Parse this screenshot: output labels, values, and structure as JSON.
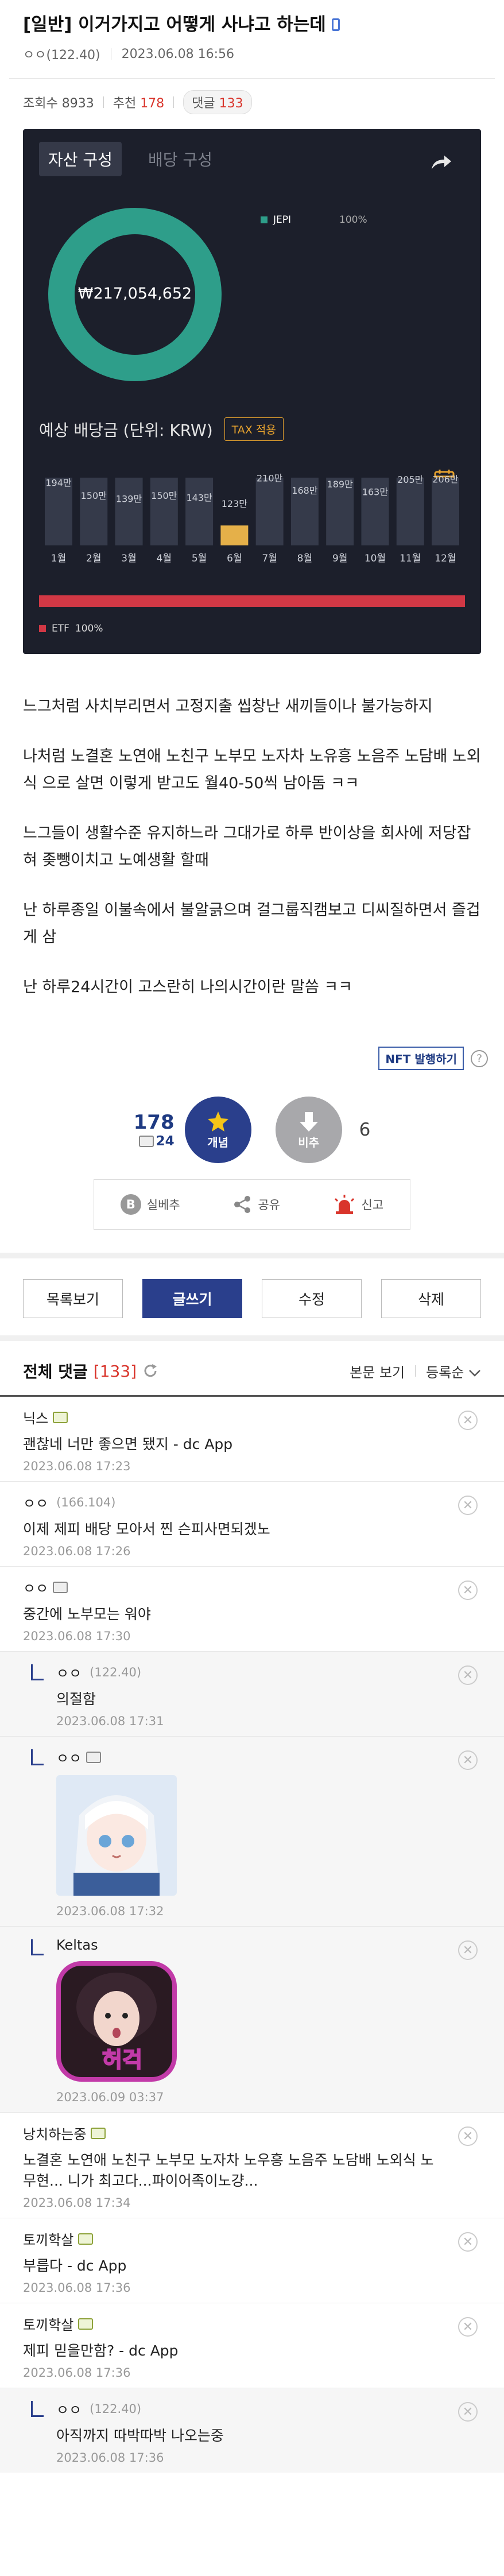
{
  "post": {
    "title": "[일반] 이거가지고 어떻게 사냐고 하는데",
    "author": "ㅇㅇ(122.40)",
    "date": "2023.06.08 16:56",
    "views_label": "조회수 8933",
    "recommend_label": "추천",
    "recommend_count": "178",
    "reply_label": "댓글",
    "reply_count": "133"
  },
  "card": {
    "tab_active": "자산 구성",
    "tab_inactive": "배당 구성",
    "total": "₩217,054,652",
    "legend_name": "JEPI",
    "legend_pct": "100%",
    "dividend_title": "예상 배당금 (단위: KRW)",
    "tax_badge": "TAX 적용",
    "etf_label": "ETF",
    "etf_pct": "100%",
    "colors": {
      "donut": "#2e9e8a",
      "bar": "#353a4a",
      "bar_highlight": "#e5b049",
      "strip": "#d13845"
    }
  },
  "chart_data": {
    "type": "bar",
    "categories": [
      "1월",
      "2월",
      "3월",
      "4월",
      "5월",
      "6월",
      "7월",
      "8월",
      "9월",
      "10월",
      "11월",
      "12월"
    ],
    "values": [
      194,
      150,
      139,
      150,
      143,
      123,
      210,
      168,
      189,
      163,
      205,
      206
    ],
    "value_labels": [
      "194만",
      "150만",
      "139만",
      "150만",
      "143만",
      "123만",
      "210만",
      "168만",
      "189만",
      "163만",
      "205만",
      "206만"
    ],
    "highlight_index": 5,
    "title": "예상 배당금 (단위: KRW)"
  },
  "body": [
    "느그처럼 사치부리면서 고정지출 씹창난 새끼들이나 불가능하지",
    "나처럼 노결혼 노연애 노친구 노부모 노자차 노유흥 노음주 노담배 노외식 으로 살면 이렇게 받고도 월40-50씩 남아돔 ㅋㅋ",
    "느그들이 생활수준 유지하느라 그대가로 하루 반이상을 회사에 저당잡혀 좆뺑이치고 노예생활 할때",
    "난 하루종일 이불속에서 불알긁으며 걸그룹직캠보고 디씨질하면서 즐겁게 삼",
    "난 하루24시간이 고스란히 나의시간이란 말씀 ㅋㅋ"
  ],
  "nft_button": "NFT 발행하기",
  "help": "?",
  "vote": {
    "up_count": "178",
    "fix_count": "24",
    "up_label": "개념",
    "down_label": "비추",
    "down_count": "6"
  },
  "actions": {
    "b": "B",
    "silbe": "실베추",
    "share": "공유",
    "report": "신고"
  },
  "buttons": {
    "list": "목록보기",
    "write": "글쓰기",
    "edit": "수정",
    "delete": "삭제"
  },
  "comments_head": {
    "title": "전체 댓글",
    "count": "[133]",
    "view_body": "본문 보기",
    "sort": "등록순"
  },
  "comments": [
    {
      "name": "닉스",
      "text": "괜찮네 너만 좋으면 됐지 - dc App",
      "date": "2023.06.08 17:23"
    },
    {
      "name": "ㅇㅇ",
      "ip": "(166.104)",
      "text": "이제 제피 배당 모아서 찐 슨피사면되겠노",
      "date": "2023.06.08 17:26"
    },
    {
      "name": "ㅇㅇ",
      "text": "중간에 노부모는 워야",
      "date": "2023.06.08 17:30"
    },
    {
      "name": "ㅇㅇ",
      "ip": "(122.40)",
      "text": "의절함",
      "date": "2023.06.08 17:31"
    },
    {
      "name": "ㅇㅇ",
      "date": "2023.06.08 17:32"
    },
    {
      "name": "Keltas",
      "date": "2023.06.09 03:37",
      "sticker_text": "허걱"
    },
    {
      "name": "낭치하는중",
      "text": "노결혼 노연애 노친구 노부모 노자차 노우흥 노음주 노담배 노외식 노무현... 니가 최고다...파이어족이노걍...",
      "date": "2023.06.08 17:34"
    },
    {
      "name": "토끼학살",
      "text": "부릅다 - dc App",
      "date": "2023.06.08 17:36"
    },
    {
      "name": "토끼학살",
      "text": "제피 믿을만함? - dc App",
      "date": "2023.06.08 17:36"
    },
    {
      "name": "ㅇㅇ",
      "ip": "(122.40)",
      "text": "아직까지 따박따박 나오는중",
      "date": "2023.06.08 17:36"
    }
  ],
  "close_glyph": "✕"
}
